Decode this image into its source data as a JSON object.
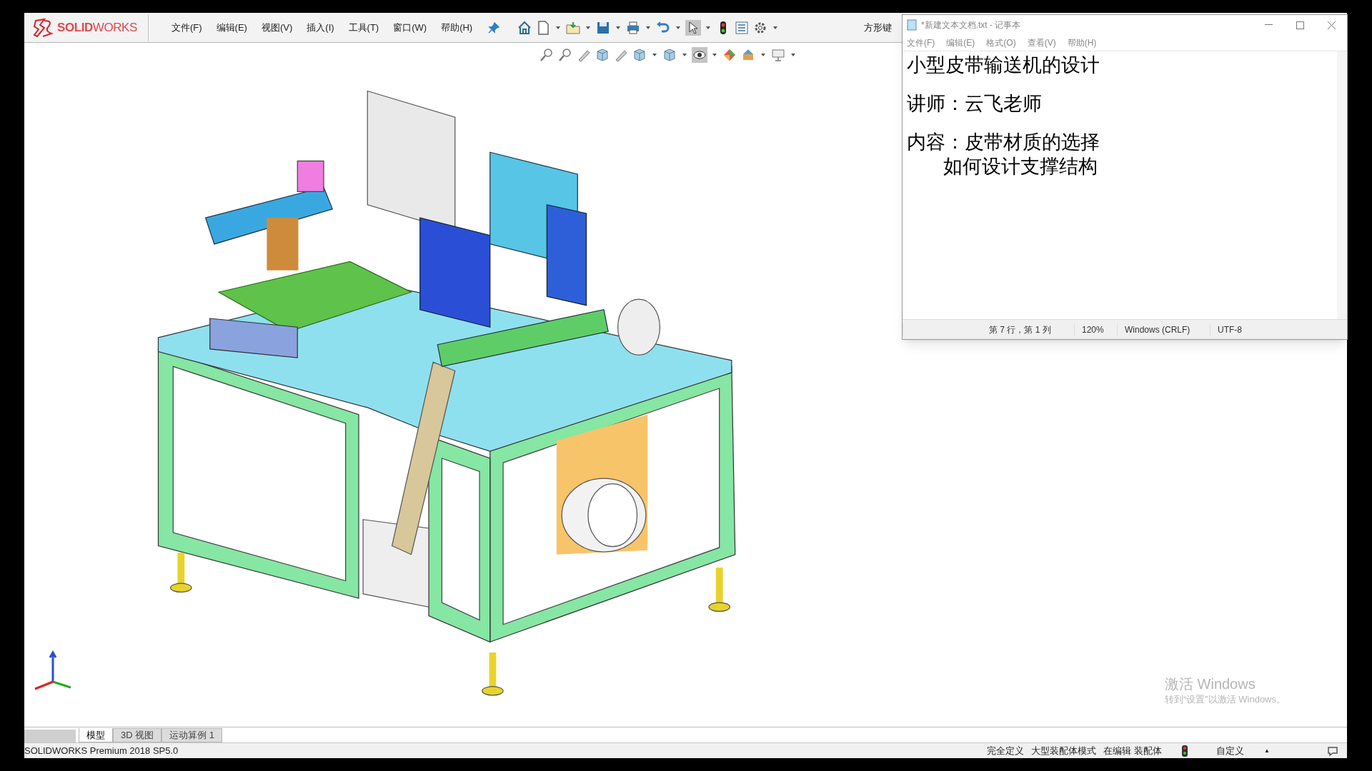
{
  "app": {
    "logo": "**SOLID**WORKS",
    "menus": [
      "文件(F)",
      "编辑(E)",
      "视图(V)",
      "插入(I)",
      "工具(T)",
      "窗口(W)",
      "帮助(H)"
    ],
    "cut_label": "方形键"
  },
  "notepad": {
    "title": "*新建文本文档.txt - 记事本",
    "menus": [
      "文件(F)",
      "编辑(E)",
      "格式(O)",
      "查看(V)",
      "帮助(H)"
    ],
    "lines": [
      "小型皮带输送机的设计",
      "讲师：云飞老师",
      "内容：皮带材质的选择",
      "      如何设计支撑结构"
    ],
    "status": [
      "第 7 行，第 1 列",
      "120%",
      "Windows (CRLF)",
      "UTF-8"
    ]
  },
  "activation": {
    "title": "激活 Windows",
    "subtitle": "转到“设置”以激活 Windows。"
  },
  "bottom_tabs": [
    {
      "label": "模型",
      "selected": true
    },
    {
      "label": "3D 视图",
      "selected": false
    },
    {
      "label": "运动算例 1",
      "selected": false
    }
  ],
  "status_bar": {
    "product": "SOLIDWORKS Premium 2018 SP5.0",
    "items": [
      "完全定义",
      "大型装配体模式",
      "在编辑 装配体"
    ],
    "custom": "自定义",
    "arrow": "▲"
  }
}
